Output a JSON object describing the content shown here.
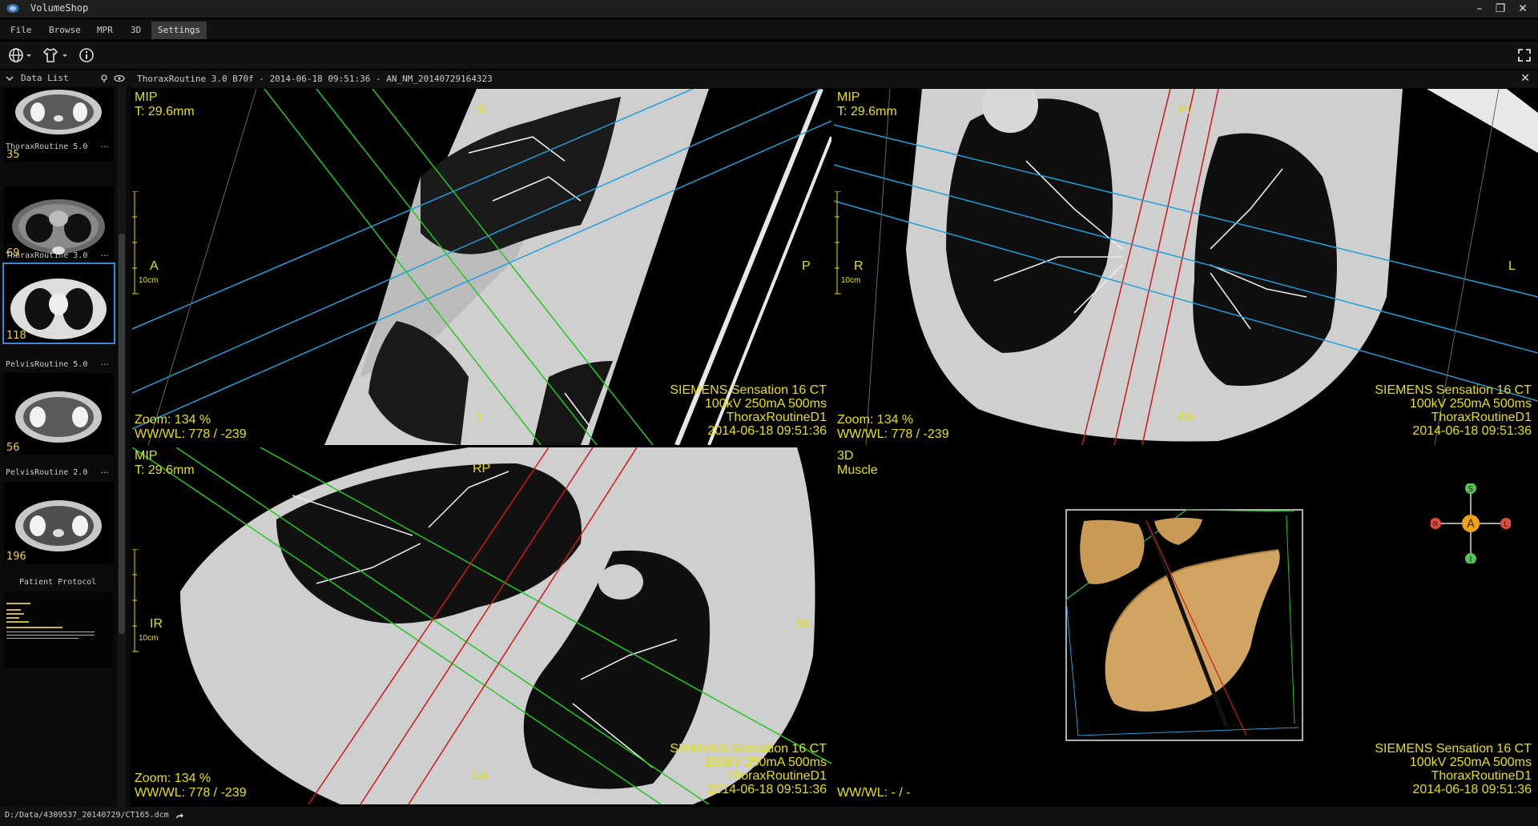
{
  "app": {
    "title": "VolumeShop"
  },
  "menu": [
    "File",
    "Browse",
    "MPR",
    "3D",
    "Settings"
  ],
  "datalist": {
    "label": "Data List",
    "series": [
      {
        "label": "",
        "count": "35"
      },
      {
        "label": "ThoraxRoutine  5.0",
        "count": "69"
      },
      {
        "label": "ThoraxRoutine  3.0",
        "count": "118"
      },
      {
        "label": "PelvisRoutine  5.0",
        "count": "56"
      },
      {
        "label": "PelvisRoutine  2.0",
        "count": "196"
      }
    ],
    "protocol_label": "Patient Protocol",
    "more": "..."
  },
  "viewer": {
    "series_info": "ThoraxRoutine  3.0  B70f - 2014-06-18 09:51:36 - AN_NM_20140729164323"
  },
  "views": {
    "sagittal": {
      "mode": "MIP",
      "thickness": "T: 29.6mm",
      "zoom": "Zoom: 134 %",
      "wwwl": "WW/WL: 778 / -239",
      "top": "S",
      "bottom": "I",
      "left": "A",
      "right": "P",
      "scale": "10cm"
    },
    "axial": {
      "mode": "MIP",
      "thickness": "T: 29.6mm",
      "zoom": "Zoom: 134 %",
      "wwwl": "WW/WL: 778 / -239",
      "top": "PI",
      "bottom": "AS",
      "left": "R",
      "right": "L",
      "scale": "10cm"
    },
    "coronal": {
      "mode": "MIP",
      "thickness": "T: 29.6mm",
      "zoom": "Zoom: 134 %",
      "wwwl": "WW/WL: 778 / -239",
      "top": "RP",
      "bottom": "LA",
      "left": "IR",
      "right": "SL",
      "scale": "10cm"
    },
    "render3d": {
      "mode": "3D",
      "preset": "Muscle",
      "wwwl": "WW/WL: - / -"
    }
  },
  "scanner": {
    "l1": "SIEMENS  Sensation 16  CT",
    "l2": "100kV  250mA  500ms",
    "l3": "ThoraxRoutineD1",
    "l4": "2014-06-18 09:51:36"
  },
  "orientation_cube": {
    "s": "S",
    "a": "A",
    "r": "R",
    "l": "L",
    "i": "I"
  },
  "status": {
    "path": "D:/Data/4309537_20140729/CT165.dcm"
  },
  "colors": {
    "overlay": "#e5e000",
    "green_plane": "#22c722",
    "blue_plane": "#1f9fd8",
    "red_plane": "#d01818"
  }
}
